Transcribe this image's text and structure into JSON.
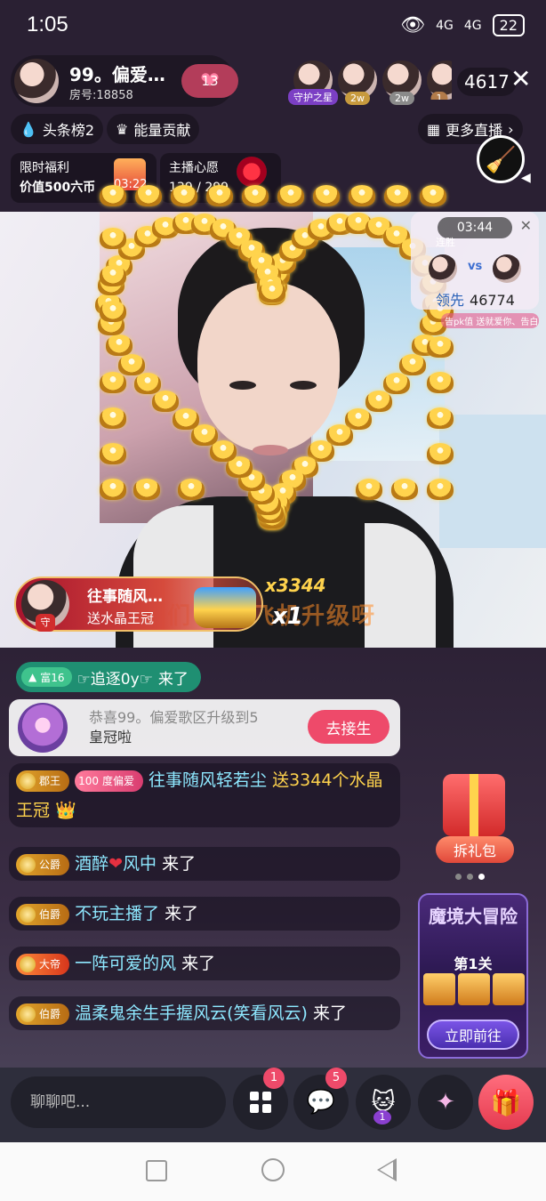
{
  "status_bar": {
    "time": "1:05",
    "signal1": "4G",
    "signal2": "4G",
    "battery": "22"
  },
  "header": {
    "anchor_name": "99。偏爱…",
    "room_number": "房号:18858",
    "heart_count": "13",
    "viewers": [
      {
        "tag": "守护之星"
      },
      {
        "tag": "2w"
      },
      {
        "tag": "2w"
      },
      {
        "tag": "1"
      }
    ],
    "online_count": "4617"
  },
  "chips": {
    "headline": "头条榜2",
    "energy": "能量贡献",
    "more_live": "更多直播"
  },
  "promo": {
    "limited_title": "限时福利",
    "limited_value": "价值500六币",
    "limited_timer": "03:22",
    "wish_title": "主播心愿",
    "wish_progress": "139 / 299"
  },
  "pk": {
    "timer": "03:44",
    "win_label": "连胜",
    "vs": "vs",
    "lead_label": "领先",
    "lead_score": "46774",
    "ticker": "告pk值   送就爱你、告白"
  },
  "gift_banner": {
    "name": "往事随风…",
    "action": "送水晶王冠",
    "guard": "守",
    "combo": "x3344",
    "combo_x": "x1",
    "overlay_text": "哥们      十个飞机升级呀"
  },
  "chat": {
    "enter": {
      "level": "富16",
      "name": "☞追逐0y☞",
      "action": "来了"
    },
    "system": {
      "text": "恭喜99。偏爱歌区升级到5",
      "text2": "皇冠啦",
      "button": "去接生"
    },
    "messages": [
      {
        "badge": "郡王",
        "fan_level": "100",
        "fan_label": "度偏爱",
        "name": "往事随风轻若尘",
        "gift": "送3344个水晶王冠"
      },
      {
        "badge": "公爵",
        "name_a": "酒醉",
        "heart": "❤",
        "name_b": "风中",
        "action": "来了"
      },
      {
        "badge": "伯爵",
        "name": "不玩主播了",
        "action": "来了"
      },
      {
        "badge": "大帝",
        "name": "一阵可爱的风",
        "action": "来了"
      },
      {
        "badge": "伯爵",
        "name": "温柔鬼余生手握风云(笑看风云)",
        "action": "来了"
      }
    ]
  },
  "side": {
    "pack_button": "拆礼包",
    "adventure_title": "魔境大冒险",
    "adventure_stage": "第1关",
    "adventure_button": "立即前往"
  },
  "bottom": {
    "placeholder": "聊聊吧...",
    "badge_more": "1",
    "badge_msg": "5",
    "badge_game": "1"
  }
}
